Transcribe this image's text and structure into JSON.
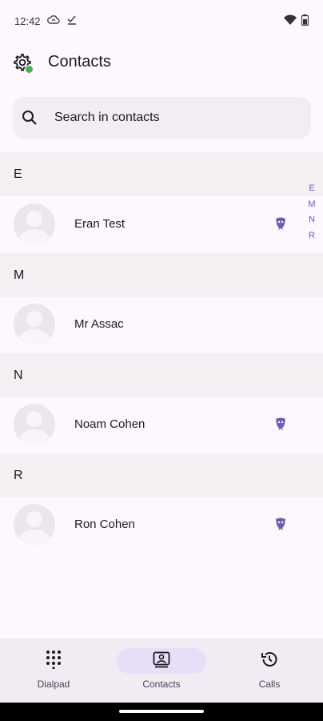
{
  "status_bar": {
    "time": "12:42"
  },
  "header": {
    "title": "Contacts"
  },
  "search": {
    "placeholder": "Search in contacts"
  },
  "sections": [
    {
      "letter": "E",
      "contacts": [
        {
          "name": "Eran Test",
          "has_app_badge": true
        }
      ]
    },
    {
      "letter": "M",
      "contacts": [
        {
          "name": "Mr Assac",
          "has_app_badge": false
        }
      ]
    },
    {
      "letter": "N",
      "contacts": [
        {
          "name": "Noam Cohen",
          "has_app_badge": true
        }
      ]
    },
    {
      "letter": "R",
      "contacts": [
        {
          "name": "Ron Cohen",
          "has_app_badge": true
        }
      ]
    }
  ],
  "alpha_index": [
    "E",
    "M",
    "N",
    "R"
  ],
  "bottom_nav": {
    "items": [
      {
        "label": "Dialpad",
        "icon": "dialpad-icon",
        "active": false
      },
      {
        "label": "Contacts",
        "icon": "contacts-icon",
        "active": true
      },
      {
        "label": "Calls",
        "icon": "history-icon",
        "active": false
      }
    ]
  },
  "colors": {
    "background": "#fdf8fd",
    "section_header": "#f3eff3",
    "search_bg": "#f2ecf4",
    "nav_bg": "#f1ecf4",
    "active_pill": "#e8def8",
    "accent": "#6a5db3",
    "online_dot": "#4caf50"
  }
}
